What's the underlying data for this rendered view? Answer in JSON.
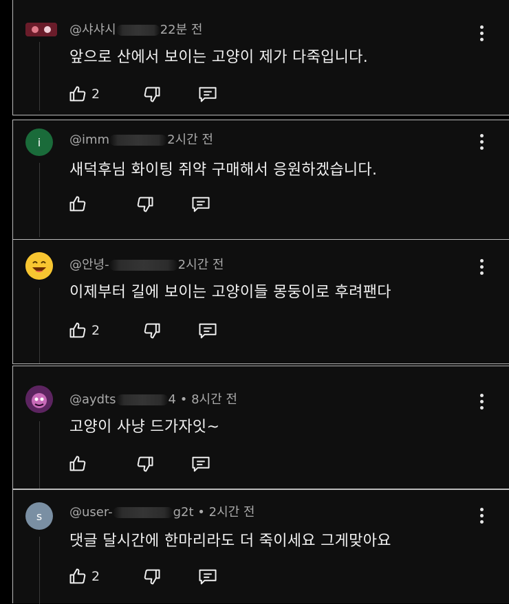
{
  "comments": [
    {
      "handle_visible": "@샤샤시",
      "time": "22분 전",
      "text": "앞으로 산에서 보이는 고양이 제가 다죽입니다.",
      "likes": "2",
      "avatar_letter": "",
      "avatar_color": "#7a1f2e"
    },
    {
      "handle_visible": "@imm",
      "time": "2시간 전",
      "text": "새덕후님 화이팅 쥐약 구매해서 응원하겠습니다.",
      "likes": "",
      "avatar_letter": "i",
      "avatar_color": "#1a6b3a"
    },
    {
      "handle_visible": "@안녕-",
      "time": "2시간 전",
      "text": "이제부터 길에 보이는 고양이들 몽둥이로 후려팬다",
      "likes": "2",
      "avatar_letter": "",
      "avatar_color": "#f5c324"
    },
    {
      "handle_visible": "@aydts",
      "handle_suffix": "4",
      "time": "• 8시간 전",
      "text": "고양이 사냥 드가자잇~",
      "likes": "",
      "avatar_letter": "",
      "avatar_color": "#6b2a6b"
    },
    {
      "handle_visible": "@user-",
      "handle_suffix": "g2t",
      "time": "• 2시간 전",
      "text": "댓글 달시간에 한마리라도 더 죽이세요 그게맞아요",
      "likes": "2",
      "avatar_letter": "s",
      "avatar_color": "#7a8fa3"
    }
  ],
  "icons": {
    "like": "thumbs-up-icon",
    "dislike": "thumbs-down-icon",
    "reply": "reply-comment-icon",
    "more": "more-vertical-icon"
  }
}
